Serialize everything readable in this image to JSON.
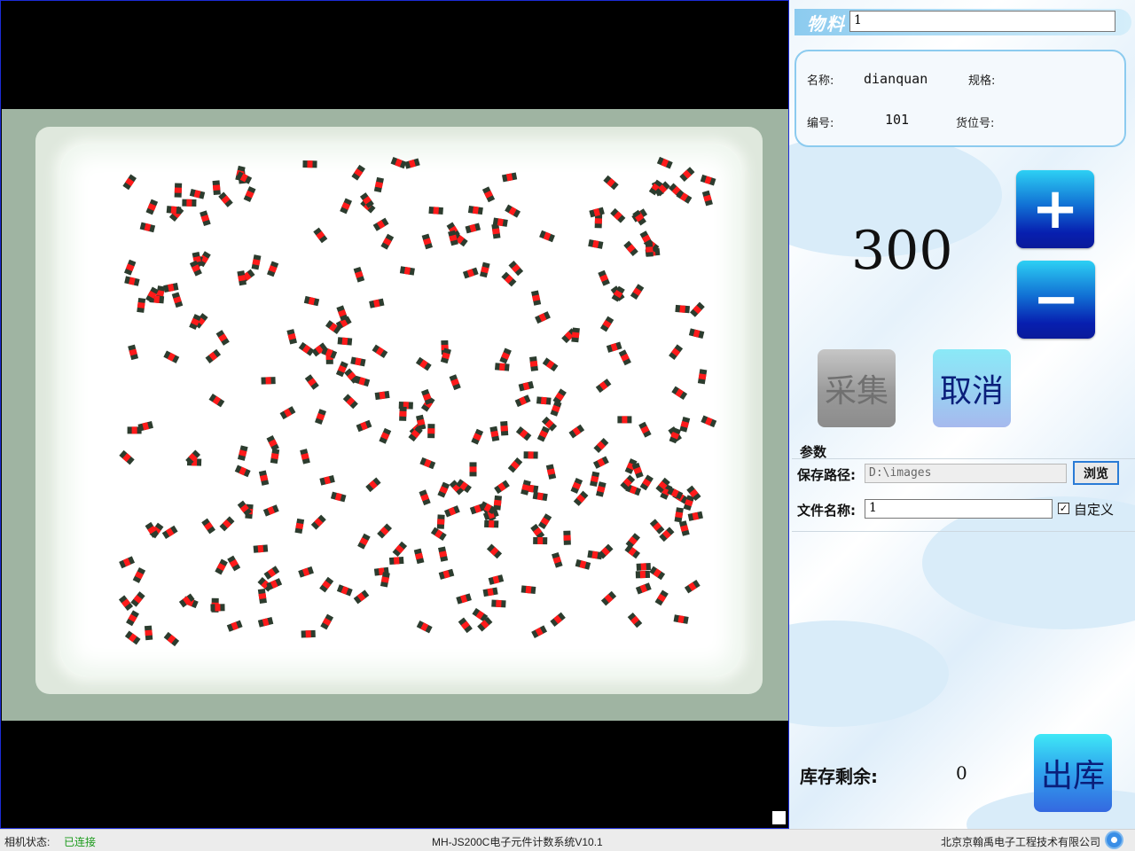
{
  "material": {
    "label": "物料",
    "value": "1"
  },
  "info": {
    "name_label": "名称:",
    "name_value": "dianquan",
    "spec_label": "规格:",
    "spec_value": "",
    "code_label": "编号:",
    "code_value": "101",
    "location_label": "货位号:",
    "location_value": ""
  },
  "counter": {
    "value": "300",
    "plus_icon": "plus-icon",
    "minus_icon": "minus-icon"
  },
  "actions": {
    "collect": "采集",
    "cancel": "取消",
    "checkout": "出库"
  },
  "params": {
    "title": "参数",
    "save_path_label": "保存路径:",
    "save_path_value": "D:\\images",
    "browse": "浏览",
    "file_name_label": "文件名称:",
    "file_name_value": "1",
    "custom_label": "自定义",
    "custom_checked": true
  },
  "stock": {
    "label": "库存剩余:",
    "value": "0"
  },
  "status_bar": {
    "camera_state_label": "相机状态:",
    "camera_state_value": "已连接",
    "camera_state_color": "#1a9a1a",
    "app_title": "MH-JS200C电子元件计数系统V10.1",
    "company": "北京京翰禹电子工程技术有限公司",
    "settings_icon": "gear-icon"
  },
  "colors": {
    "button_blue": "#0a1fa8",
    "accent_light_blue": "#8ccbef",
    "part_body": "#2c3c2e",
    "part_mark": "#ff1a1a"
  }
}
